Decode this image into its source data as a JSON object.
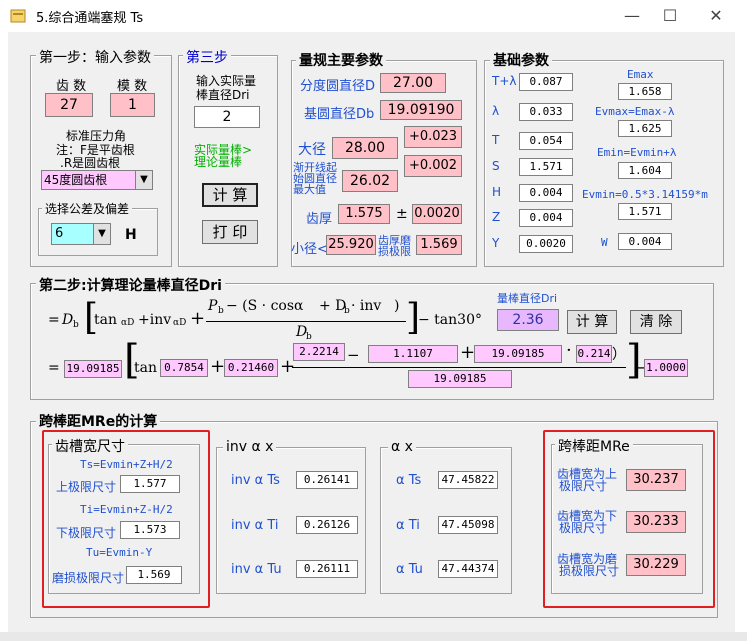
{
  "window": {
    "title": "5.综合通端塞规 Ts",
    "minimize": "—",
    "maximize": "☐",
    "close": "✕"
  },
  "step1": {
    "legend": "第一步：输入参数",
    "teeth_label": "齿 数",
    "module_label": "模 数",
    "teeth_value": "27",
    "module_value": "1",
    "note_line1": "标准压力角",
    "note_line2": "注：F是平齿根",
    "note_line3": ".R是圆齿根",
    "root_type_value": "45度圆齿根",
    "tolerance_legend": "选择公差及偏差",
    "tolerance_value": "6",
    "tolerance_letter": "H"
  },
  "step3": {
    "legend": "第三步",
    "input_label_line1": "输入实际量",
    "input_label_line2": "棒直径Dri",
    "input_value": "2",
    "hint_line1": "实际量棒>",
    "hint_line2": "理论量棒",
    "calc_button": "计 算",
    "print_button": "打 印"
  },
  "gauge_params": {
    "legend": "量规主要参数",
    "pitch_dia_label": "分度圆直径D",
    "pitch_dia_value": "27.00",
    "base_dia_label": "基圆直径Db",
    "base_dia_value": "19.09190",
    "major_dia_label": "大径",
    "major_dia_value": "28.00",
    "major_tol_upper": "+0.023",
    "major_tol_lower": "+0.002",
    "involute_label_line1": "渐开线起",
    "involute_label_line2": "始圆直径",
    "involute_label_line3": "最大值",
    "involute_value": "26.02",
    "tooth_thick_label": "齿厚",
    "tooth_thick_value": "1.575",
    "pm": "±",
    "tooth_thick_tol": "0.0020",
    "minor_dia_label": "小径<",
    "minor_dia_value": "25.920",
    "wear_label_line1": "齿厚磨",
    "wear_label_line2": "损极限",
    "wear_value": "1.569"
  },
  "basic_params": {
    "legend": "基础参数",
    "rows": [
      {
        "label": "T+λ",
        "value": "0.087"
      },
      {
        "label": "λ",
        "value": "0.033"
      },
      {
        "label": "T",
        "value": "0.054"
      },
      {
        "label": "S",
        "value": "1.571"
      },
      {
        "label": "H",
        "value": "0.004"
      },
      {
        "label": "Z",
        "value": "0.004"
      },
      {
        "label": "Y",
        "value": "0.0020"
      }
    ],
    "emax_label": "Emax",
    "emax_value": "1.658",
    "evmax_label": "Evmax=Emax-λ",
    "evmax_value": "1.625",
    "emin_label": "Emin=Evmin+λ",
    "emin_value": "1.604",
    "evmin_label": "Evmin=0.5*3.14159*m",
    "evmin_value": "1.571",
    "w_label": "W",
    "w_value": "0.004"
  },
  "step2": {
    "legend": "第二步:计算理论量棒直径Dri",
    "dri_label": "量棒直径Dri",
    "dri_value": "2.36",
    "calc_button": "计 算",
    "clear_button": "清 除",
    "formula": {
      "eq": "=",
      "Db": "D",
      "b_sub": "b",
      "tan": "tan",
      "inv": "+inv",
      "alpha_D": "αD",
      "alpha_D_sub": "αD",
      "num_left": "P",
      "num_mid": " − (S · cosα",
      "num_plus": " + D",
      "num_inv": " · inv",
      "num_close": ")",
      "den": "D",
      "tail": "− tan30°",
      "r2_v1": "19.09185",
      "r2_v2": "0.7854",
      "r2_v3": "0.21460",
      "r2_v4": "2.2214",
      "r2_v5": "1.1107",
      "r2_v6": "19.09185",
      "r2_v7": "0.214",
      "r2_v8": "19.09185",
      "r2_v9": "1.0000"
    }
  },
  "mre": {
    "legend": "跨棒距MRe的计算",
    "slot_width": {
      "legend": "齿槽宽尺寸",
      "ts_formula": "Ts=Evmin+Z+H/2",
      "upper_label": "上极限尺寸",
      "upper_value": "1.577",
      "ti_formula": "Ti=Evmin+Z-H/2",
      "lower_label": "下极限尺寸",
      "lower_value": "1.573",
      "tu_formula": "Tu=Evmin-Y",
      "wear_label": "磨损极限尺寸",
      "wear_value": "1.569"
    },
    "inv_alpha": {
      "legend": "inv α x",
      "rows": [
        {
          "label": "inv α Ts",
          "value": "0.26141"
        },
        {
          "label": "inv α Ti",
          "value": "0.26126"
        },
        {
          "label": "inv α Tu",
          "value": "0.26111"
        }
      ]
    },
    "alpha": {
      "legend": "α x",
      "rows": [
        {
          "label": "α Ts",
          "value": "47.45822"
        },
        {
          "label": "α Ti",
          "value": "47.45098"
        },
        {
          "label": "α Tu",
          "value": "47.44374"
        }
      ]
    },
    "span": {
      "legend": "跨棒距MRe",
      "rows": [
        {
          "label_line1": "齿槽宽为上",
          "label_line2": "极限尺寸",
          "value": "30.237"
        },
        {
          "label_line1": "齿槽宽为下",
          "label_line2": "极限尺寸",
          "value": "30.233"
        },
        {
          "label_line1": "齿槽宽为磨",
          "label_line2": "损极限尺寸",
          "value": "30.229"
        }
      ]
    }
  },
  "colors": {
    "pink": "#ffc0c8",
    "highlight_red": "#e02020",
    "label_blue": "#2050d0",
    "hint_green": "#00b000"
  }
}
